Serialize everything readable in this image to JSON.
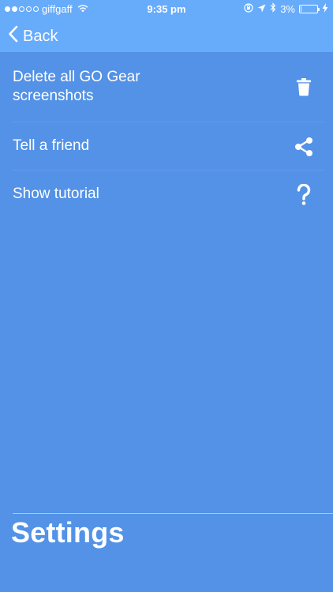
{
  "status_bar": {
    "carrier": "giffgaff",
    "time": "9:35 pm",
    "battery_percent": "3%",
    "battery_level": 0.03,
    "signal_bars_filled": 2,
    "signal_bars_total": 5,
    "icons": [
      "wifi-icon",
      "orientation-lock-icon",
      "location-arrow-icon",
      "bluetooth-icon",
      "battery-icon",
      "charging-bolt-icon"
    ]
  },
  "nav": {
    "back_label": "Back"
  },
  "menu": {
    "items": [
      {
        "label": "Delete all GO Gear screenshots",
        "icon": "trash-icon"
      },
      {
        "label": "Tell a friend",
        "icon": "share-icon"
      },
      {
        "label": "Show tutorial",
        "icon": "question-mark-icon"
      }
    ]
  },
  "page": {
    "title": "Settings"
  },
  "colors": {
    "header_bg": "#67abfb",
    "background": "#5392e6",
    "text": "#ffffff"
  }
}
